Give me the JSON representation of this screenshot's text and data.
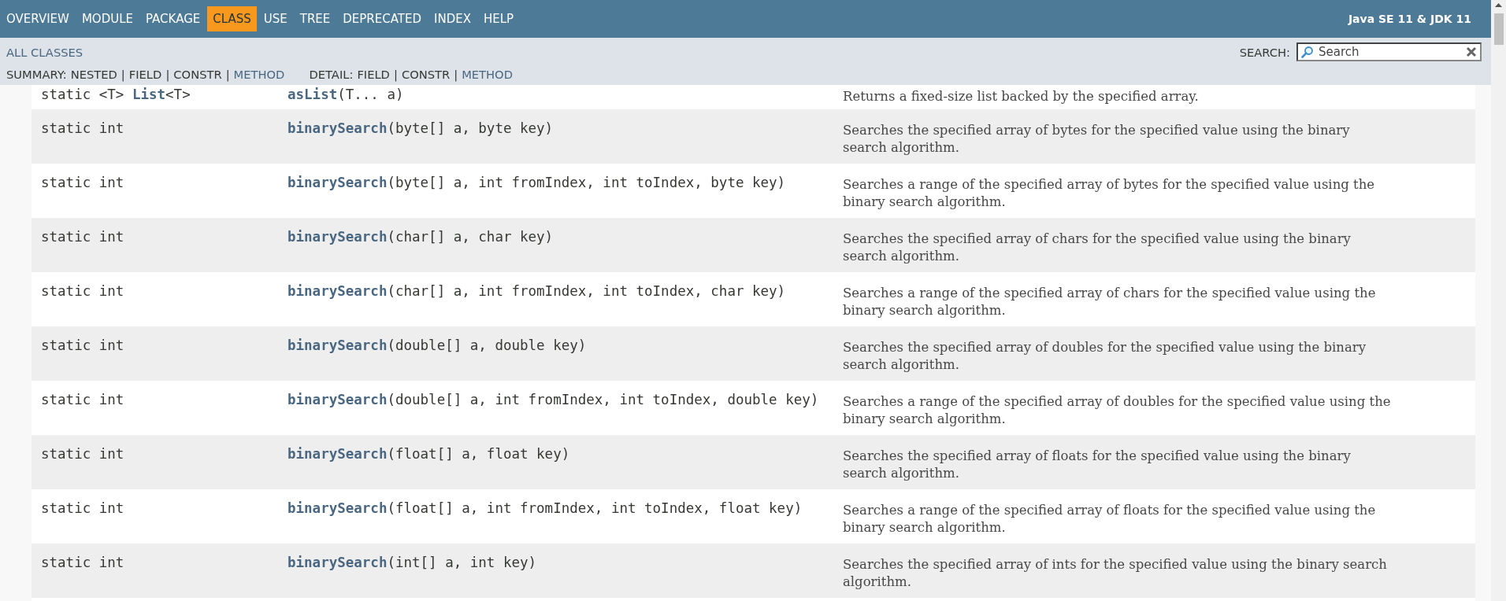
{
  "nav": {
    "items": [
      {
        "label": "OVERVIEW",
        "selected": false
      },
      {
        "label": "MODULE",
        "selected": false
      },
      {
        "label": "PACKAGE",
        "selected": false
      },
      {
        "label": "CLASS",
        "selected": true
      },
      {
        "label": "USE",
        "selected": false
      },
      {
        "label": "TREE",
        "selected": false
      },
      {
        "label": "DEPRECATED",
        "selected": false
      },
      {
        "label": "INDEX",
        "selected": false
      },
      {
        "label": "HELP",
        "selected": false
      }
    ],
    "title": "Java SE 11 & JDK 11"
  },
  "subnav": {
    "all_classes": "ALL CLASSES",
    "search_label": "SEARCH:",
    "search_placeholder": "Search",
    "separator": "|",
    "summary_label": "SUMMARY:",
    "summary": [
      {
        "label": "NESTED",
        "link": false
      },
      {
        "label": "FIELD",
        "link": false
      },
      {
        "label": "CONSTR",
        "link": false
      },
      {
        "label": "METHOD",
        "link": true
      }
    ],
    "detail_label": "DETAIL:",
    "detail": [
      {
        "label": "FIELD",
        "link": false
      },
      {
        "label": "CONSTR",
        "link": false
      },
      {
        "label": "METHOD",
        "link": true
      }
    ]
  },
  "rows": [
    {
      "type": "static <T> **List**<T>",
      "method": "asList",
      "params": "(T... a)",
      "description": "Returns a fixed-size list backed by the specified array."
    },
    {
      "type": "static int",
      "method": "binarySearch",
      "params": "(byte[] a, byte key)",
      "description": "Searches the specified array of bytes for the specified value using the binary search algorithm."
    },
    {
      "type": "static int",
      "method": "binarySearch",
      "params": "(byte[] a, int fromIndex, int toIndex, byte key)",
      "description": "Searches a range of the specified array of bytes for the specified value using the binary search algorithm."
    },
    {
      "type": "static int",
      "method": "binarySearch",
      "params": "(char[] a, char key)",
      "description": "Searches the specified array of chars for the specified value using the binary search algorithm."
    },
    {
      "type": "static int",
      "method": "binarySearch",
      "params": "(char[] a, int fromIndex, int toIndex, char key)",
      "description": "Searches a range of the specified array of chars for the specified value using the binary search algorithm."
    },
    {
      "type": "static int",
      "method": "binarySearch",
      "params": "(double[] a, double key)",
      "description": "Searches the specified array of doubles for the specified value using the binary search algorithm."
    },
    {
      "type": "static int",
      "method": "binarySearch",
      "params": "(double[] a, int fromIndex, int toIndex, double key)",
      "description": "Searches a range of the specified array of doubles for the specified value using the binary search algorithm."
    },
    {
      "type": "static int",
      "method": "binarySearch",
      "params": "(float[] a, float key)",
      "description": "Searches the specified array of floats for the specified value using the binary search algorithm."
    },
    {
      "type": "static int",
      "method": "binarySearch",
      "params": "(float[] a, int fromIndex, int toIndex, float key)",
      "description": "Searches a range of the specified array of floats for the specified value using the binary search algorithm."
    },
    {
      "type": "static int",
      "method": "binarySearch",
      "params": "(int[] a, int key)",
      "description": "Searches the specified array of ints for the specified value using the binary search algorithm."
    }
  ]
}
